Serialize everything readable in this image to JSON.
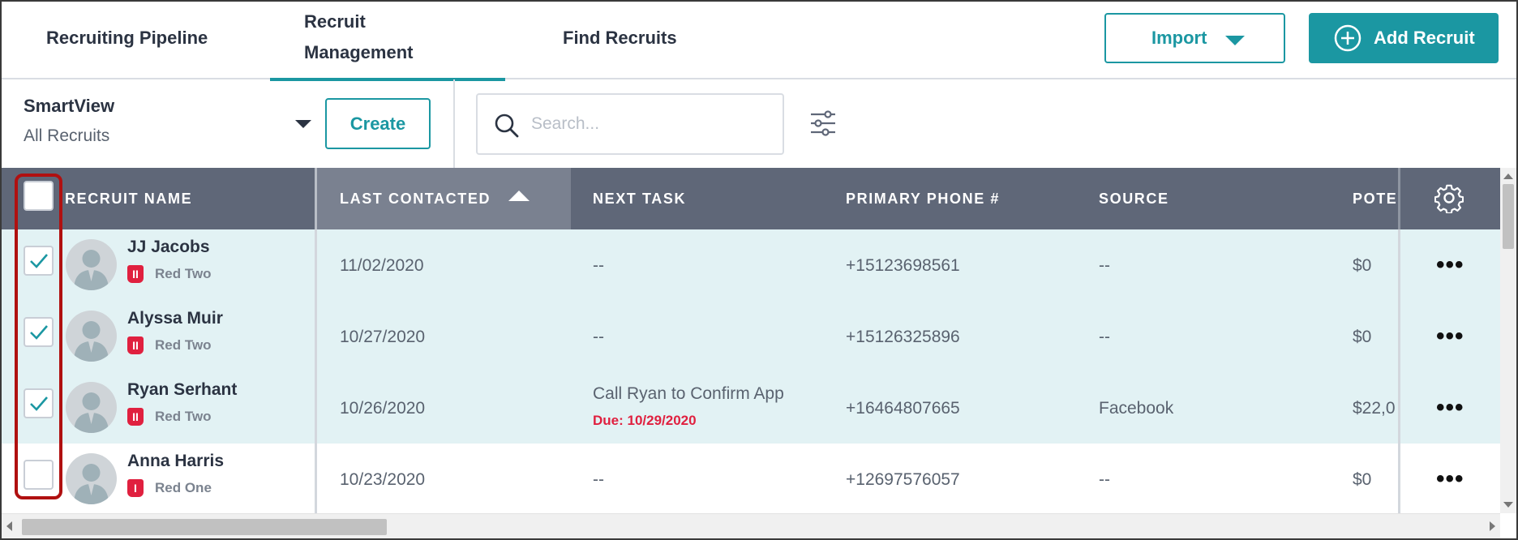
{
  "nav": {
    "tabs": [
      {
        "label": "Recruiting Pipeline"
      },
      {
        "label": "Recruit Management",
        "active": true
      },
      {
        "label": "Find Recruits"
      }
    ],
    "import_label": "Import",
    "add_label": "Add Recruit"
  },
  "toolbar": {
    "smartview_label": "SmartView",
    "smartview_value": "All Recruits",
    "create_label": "Create",
    "search_placeholder": "Search..."
  },
  "table": {
    "columns": [
      "RECRUIT NAME",
      "LAST CONTACTED",
      "NEXT TASK",
      "PRIMARY PHONE #",
      "SOURCE",
      "POTE"
    ],
    "sorted_column": "LAST CONTACTED",
    "sort_direction": "ascending",
    "rows": [
      {
        "name": "JJ Jacobs",
        "team": "Red Two",
        "badge": "II",
        "checked": true,
        "last_contacted": "11/02/2020",
        "next_task": "--",
        "next_task_due": "",
        "phone": "+15123698561",
        "source": "--",
        "potential": "$0"
      },
      {
        "name": "Alyssa Muir",
        "team": "Red Two",
        "badge": "II",
        "checked": true,
        "last_contacted": "10/27/2020",
        "next_task": "--",
        "next_task_due": "",
        "phone": "+15126325896",
        "source": "--",
        "potential": "$0"
      },
      {
        "name": "Ryan Serhant",
        "team": "Red Two",
        "badge": "II",
        "checked": true,
        "last_contacted": "10/26/2020",
        "next_task": "Call Ryan to Confirm App",
        "next_task_due": "Due: 10/29/2020",
        "phone": "+16464807665",
        "source": "Facebook",
        "potential": "$22,0"
      },
      {
        "name": "Anna Harris",
        "team": "Red One",
        "badge": "I",
        "checked": false,
        "last_contacted": "10/23/2020",
        "next_task": "--",
        "next_task_due": "",
        "phone": "+12697576057",
        "source": "--",
        "potential": "$0"
      }
    ],
    "row_menu_label": "•••"
  },
  "colors": {
    "accent": "#1b97a2",
    "header_bg": "#5f6778",
    "selected_row_bg": "#e2f2f4",
    "badge_red": "#e0203f",
    "highlight_box": "#b01010"
  }
}
